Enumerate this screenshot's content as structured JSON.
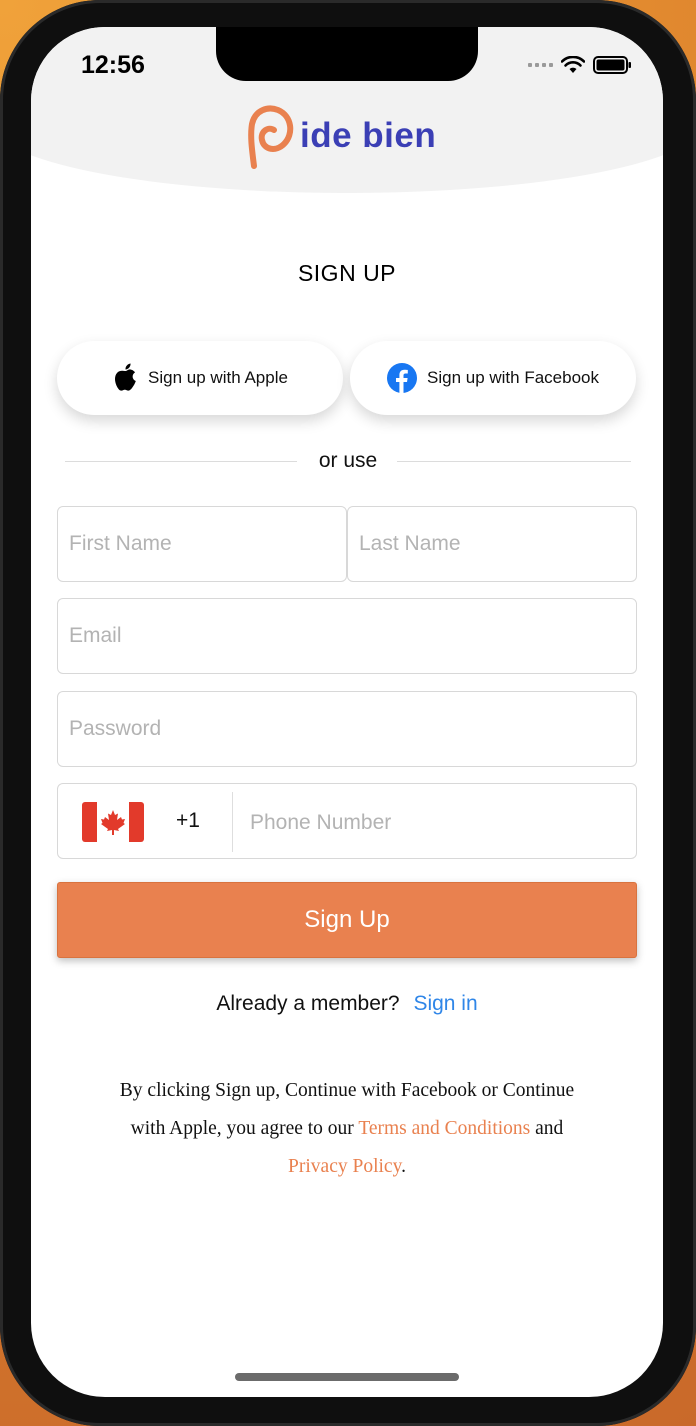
{
  "status_bar": {
    "time": "12:56"
  },
  "app": {
    "logo_text": "ide bien",
    "brand_color": "#3b3fb5",
    "accent_color": "#e9814f"
  },
  "page": {
    "title": "SIGN UP"
  },
  "social": {
    "apple_label": "Sign up with Apple",
    "facebook_label": "Sign up with Facebook",
    "apple_icon": "apple-icon",
    "facebook_icon": "facebook-icon"
  },
  "divider": {
    "text": "or use"
  },
  "form": {
    "first_name": {
      "placeholder": "First Name",
      "value": ""
    },
    "last_name": {
      "placeholder": "Last Name",
      "value": ""
    },
    "email": {
      "placeholder": "Email",
      "value": ""
    },
    "password": {
      "placeholder": "Password",
      "value": ""
    },
    "phone": {
      "country_flag": "canada-flag",
      "country_code": "+1",
      "placeholder": "Phone Number",
      "value": ""
    },
    "submit_label": "Sign Up"
  },
  "member": {
    "prompt": "Already a member?",
    "link": "Sign in",
    "link_color": "#2f86e8"
  },
  "terms": {
    "text_1": "By clicking Sign up, Continue with Facebook or Continue with Apple, you agree to our ",
    "terms_link": "Terms and Conditions",
    "text_2": " and ",
    "privacy_link": "Privacy Policy",
    "text_3": "."
  }
}
